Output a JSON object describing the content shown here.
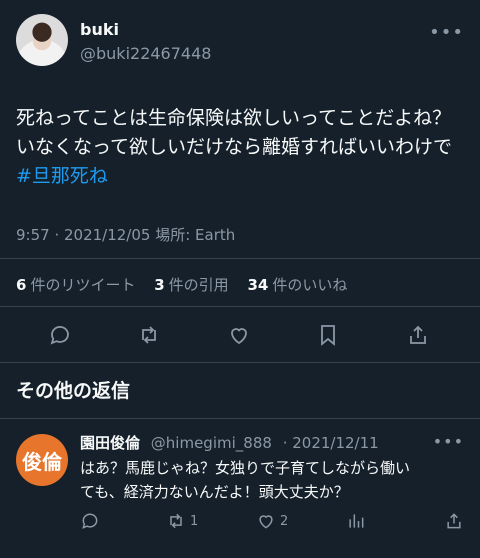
{
  "tweet": {
    "display_name": "buki",
    "handle": "@buki22467448",
    "more_icon": "more-horizontal-icon",
    "text_line1": "死ねってことは生命保険は欲しいってことだよね？",
    "text_line2": "いなくなって欲しいだけなら離婚すればいいわけで",
    "hashtag": "#旦那死ね",
    "meta": "9:57 · 2021/12/05 場所: Earth"
  },
  "stats": {
    "retweets_count": "6",
    "retweets_label": "件のリツイート",
    "quotes_count": "3",
    "quotes_label": "件の引用",
    "likes_count": "34",
    "likes_label": "件のいいね"
  },
  "actions": [
    "reply-icon",
    "retweet-icon",
    "like-icon",
    "bookmark-icon",
    "share-icon"
  ],
  "replies_section": {
    "title": "その他の返信"
  },
  "reply": {
    "avatar_text": "俊倫",
    "display_name": "園田俊倫",
    "handle": "@himegimi_888",
    "date": "· 2021/12/11",
    "text_line1": "はあ？馬鹿じゃね？女独りで子育てしながら働い",
    "text_line2": "ても、経済力ないんだよ！頭大丈夫か？",
    "retweet_count": "1",
    "like_count": "2"
  },
  "colors": {
    "background": "#15202b",
    "accent": "#1d9bf0",
    "muted": "#8b98a5",
    "reply_avatar": "#e7752b"
  }
}
